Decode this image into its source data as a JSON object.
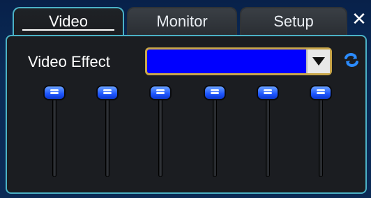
{
  "tabs": [
    {
      "label": "Video",
      "active": true
    },
    {
      "label": "Monitor",
      "active": false
    },
    {
      "label": "Setup",
      "active": false
    }
  ],
  "close": {
    "icon": "close-icon",
    "glyph": "✕"
  },
  "video": {
    "effect_label": "Video Effect",
    "effect_select": {
      "value": "",
      "bg": "#0000ff",
      "border": "#c9a64a"
    },
    "refresh_icon": "refresh-icon",
    "sliders": [
      {
        "name": "slider-1",
        "level": 1.0
      },
      {
        "name": "slider-2",
        "level": 1.0
      },
      {
        "name": "slider-3",
        "level": 1.0
      },
      {
        "name": "slider-4",
        "level": 1.0
      },
      {
        "name": "slider-5",
        "level": 1.0
      },
      {
        "name": "slider-6",
        "level": 1.0
      }
    ]
  },
  "colors": {
    "accent": "#4bb2c6",
    "panel": "#1b1d21",
    "thumb": "#1d55ff"
  }
}
